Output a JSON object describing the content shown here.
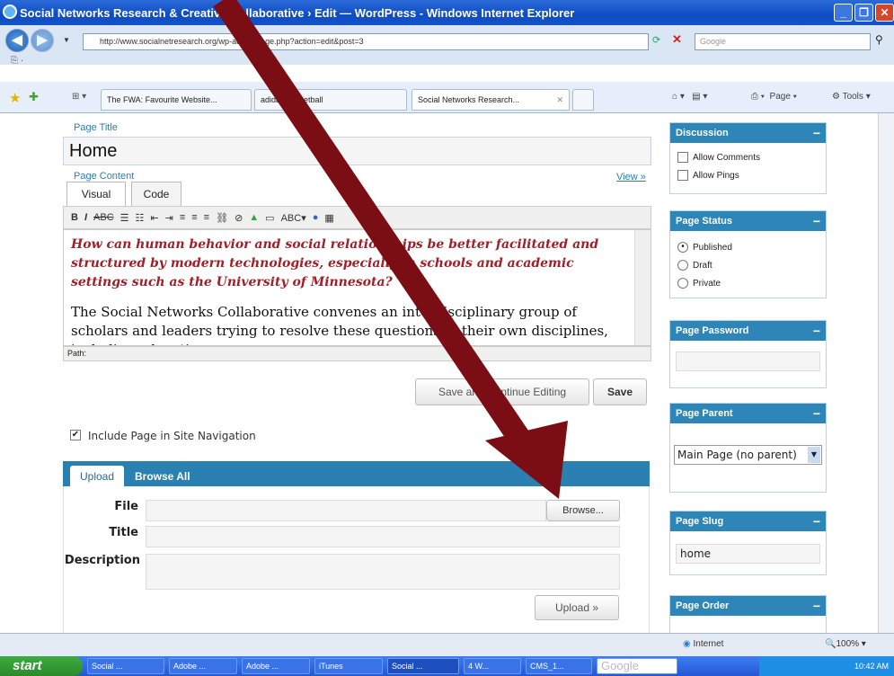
{
  "window": {
    "title": "Social Networks Research & Creative Collaborative › Edit — WordPress - Windows Internet Explorer",
    "url": "http://www.socialnetresearch.org/wp-admin/page.php?action=edit&post=3",
    "search_placeholder": "Google"
  },
  "browser_tabs": [
    {
      "label": "The FWA: Favourite Website..."
    },
    {
      "label": "adidas basketball"
    },
    {
      "label": "Social Networks Research..."
    }
  ],
  "command_bar": {
    "page_label": "Page",
    "tools_label": "Tools"
  },
  "editor": {
    "page_title_label": "Page Title",
    "page_title_value": "Home",
    "page_content_label": "Page Content",
    "view_link": "View »",
    "tab_visual": "Visual",
    "tab_code": "Code",
    "question_text": "How can human behavior and social relationships be better facilitated and structured by modern technologies, especially in schools and academic settings such as the University of Minnesota?",
    "body_text": "The Social Networks Collaborative convenes an interdisciplinary group of scholars and leaders trying to resolve these questions in their own disciplines, including education",
    "path_label": "Path:",
    "save_continue_label": "Save and Continue Editing",
    "save_label": "Save",
    "include_nav_label": "Include Page in Site Navigation",
    "include_nav_checked": true
  },
  "upload": {
    "tab_upload": "Upload",
    "tab_browse_all": "Browse All",
    "file_label": "File",
    "title_label": "Title",
    "description_label": "Description",
    "browse_label": "Browse...",
    "upload_button": "Upload »"
  },
  "sidebar": {
    "discussion": {
      "title": "Discussion",
      "allow_comments": "Allow Comments",
      "allow_pings": "Allow Pings"
    },
    "status": {
      "title": "Page Status",
      "options": [
        "Published",
        "Draft",
        "Private"
      ],
      "selected": "Published"
    },
    "password": {
      "title": "Page Password"
    },
    "parent": {
      "title": "Page Parent",
      "selected": "Main Page (no parent)"
    },
    "slug": {
      "title": "Page Slug",
      "value": "home"
    },
    "order": {
      "title": "Page Order"
    }
  },
  "statusbar": {
    "zone": "Internet",
    "zoom": "100%"
  },
  "taskbar": {
    "start": "start",
    "items": [
      "Social ...",
      "Adobe ...",
      "Adobe ...",
      "iTunes",
      "Social ...",
      "4 W...",
      "CMS_1..."
    ],
    "search_placeholder": "Google",
    "clock": "10:42 AM"
  },
  "annotation": {
    "arrow_color": "#7a0e14"
  }
}
